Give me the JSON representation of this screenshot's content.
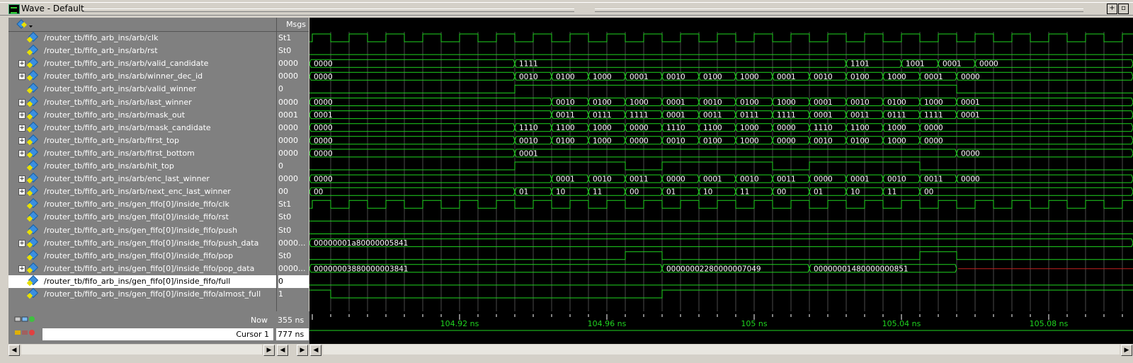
{
  "window": {
    "title": "Wave - Default"
  },
  "names_header": "",
  "values_header": "Msgs",
  "signals": [
    {
      "name": "/router_tb/fifo_arb_ins/arb/clk",
      "value": "St1",
      "expand": false,
      "kind": "clk",
      "period": 2,
      "offset": 0
    },
    {
      "name": "/router_tb/fifo_arb_ins/arb/rst",
      "value": "St0",
      "expand": false,
      "kind": "level",
      "transitions": []
    },
    {
      "name": "/router_tb/fifo_arb_ins/arb/valid_candidate",
      "value": "0000",
      "expand": true,
      "kind": "bus",
      "segs": [
        [
          "0000",
          0
        ],
        [
          "1111",
          11
        ],
        [
          "1101",
          29
        ],
        [
          "1001",
          32
        ],
        [
          "0001",
          34
        ],
        [
          "0000",
          36
        ]
      ]
    },
    {
      "name": "/router_tb/fifo_arb_ins/arb/winner_dec_id",
      "value": "0000",
      "expand": true,
      "kind": "bus",
      "segs": [
        [
          "0000",
          0
        ],
        [
          "0010",
          11
        ],
        [
          "0100",
          13
        ],
        [
          "1000",
          15
        ],
        [
          "0001",
          17
        ],
        [
          "0010",
          19
        ],
        [
          "0100",
          21
        ],
        [
          "1000",
          23
        ],
        [
          "0001",
          25
        ],
        [
          "0010",
          27
        ],
        [
          "0100",
          29
        ],
        [
          "1000",
          31
        ],
        [
          "0001",
          33
        ],
        [
          "0000",
          35
        ]
      ]
    },
    {
      "name": "/router_tb/fifo_arb_ins/arb/valid_winner",
      "value": "0",
      "expand": false,
      "kind": "level",
      "transitions": [
        0,
        11,
        35
      ]
    },
    {
      "name": "/router_tb/fifo_arb_ins/arb/last_winner",
      "value": "0000",
      "expand": true,
      "kind": "bus",
      "segs": [
        [
          "0000",
          0
        ],
        [
          "0010",
          13
        ],
        [
          "0100",
          15
        ],
        [
          "1000",
          17
        ],
        [
          "0001",
          19
        ],
        [
          "0010",
          21
        ],
        [
          "0100",
          23
        ],
        [
          "1000",
          25
        ],
        [
          "0001",
          27
        ],
        [
          "0010",
          29
        ],
        [
          "0100",
          31
        ],
        [
          "1000",
          33
        ],
        [
          "0001",
          35
        ]
      ]
    },
    {
      "name": "/router_tb/fifo_arb_ins/arb/mask_out",
      "value": "0001",
      "expand": true,
      "kind": "bus",
      "segs": [
        [
          "0001",
          0
        ],
        [
          "0011",
          13
        ],
        [
          "0111",
          15
        ],
        [
          "1111",
          17
        ],
        [
          "0001",
          19
        ],
        [
          "0011",
          21
        ],
        [
          "0111",
          23
        ],
        [
          "1111",
          25
        ],
        [
          "0001",
          27
        ],
        [
          "0011",
          29
        ],
        [
          "0111",
          31
        ],
        [
          "1111",
          33
        ],
        [
          "0001",
          35
        ]
      ]
    },
    {
      "name": "/router_tb/fifo_arb_ins/arb/mask_candidate",
      "value": "0000",
      "expand": true,
      "kind": "bus",
      "segs": [
        [
          "0000",
          0
        ],
        [
          "1110",
          11
        ],
        [
          "1100",
          13
        ],
        [
          "1000",
          15
        ],
        [
          "0000",
          17
        ],
        [
          "1110",
          19
        ],
        [
          "1100",
          21
        ],
        [
          "1000",
          23
        ],
        [
          "0000",
          25
        ],
        [
          "1110",
          27
        ],
        [
          "1100",
          29
        ],
        [
          "1000",
          31
        ],
        [
          "0000",
          33
        ]
      ]
    },
    {
      "name": "/router_tb/fifo_arb_ins/arb/first_top",
      "value": "0000",
      "expand": true,
      "kind": "bus",
      "segs": [
        [
          "0000",
          0
        ],
        [
          "0010",
          11
        ],
        [
          "0100",
          13
        ],
        [
          "1000",
          15
        ],
        [
          "0000",
          17
        ],
        [
          "0010",
          19
        ],
        [
          "0100",
          21
        ],
        [
          "1000",
          23
        ],
        [
          "0000",
          25
        ],
        [
          "0010",
          27
        ],
        [
          "0100",
          29
        ],
        [
          "1000",
          31
        ],
        [
          "0000",
          33
        ]
      ]
    },
    {
      "name": "/router_tb/fifo_arb_ins/arb/first_bottom",
      "value": "0000",
      "expand": true,
      "kind": "bus",
      "segs": [
        [
          "0000",
          0
        ],
        [
          "0001",
          11
        ],
        [
          "0000",
          35
        ]
      ]
    },
    {
      "name": "/router_tb/fifo_arb_ins/arb/hit_top",
      "value": "0",
      "expand": false,
      "kind": "level",
      "transitions": [
        0,
        11,
        17,
        19,
        25,
        27,
        33
      ]
    },
    {
      "name": "/router_tb/fifo_arb_ins/arb/enc_last_winner",
      "value": "0000",
      "expand": true,
      "kind": "bus",
      "segs": [
        [
          "0000",
          0
        ],
        [
          "0001",
          13
        ],
        [
          "0010",
          15
        ],
        [
          "0011",
          17
        ],
        [
          "0000",
          19
        ],
        [
          "0001",
          21
        ],
        [
          "0010",
          23
        ],
        [
          "0011",
          25
        ],
        [
          "0000",
          27
        ],
        [
          "0001",
          29
        ],
        [
          "0010",
          31
        ],
        [
          "0011",
          33
        ],
        [
          "0000",
          35
        ]
      ]
    },
    {
      "name": "/router_tb/fifo_arb_ins/arb/next_enc_last_winner",
      "value": "00",
      "expand": true,
      "kind": "bus",
      "segs": [
        [
          "00",
          0
        ],
        [
          "01",
          11
        ],
        [
          "10",
          13
        ],
        [
          "11",
          15
        ],
        [
          "00",
          17
        ],
        [
          "01",
          19
        ],
        [
          "10",
          21
        ],
        [
          "11",
          23
        ],
        [
          "00",
          25
        ],
        [
          "01",
          27
        ],
        [
          "10",
          29
        ],
        [
          "11",
          31
        ],
        [
          "00",
          33
        ]
      ]
    },
    {
      "name": "/router_tb/fifo_arb_ins/gen_fifo[0]/inside_fifo/clk",
      "value": "St1",
      "expand": false,
      "kind": "clk",
      "period": 2,
      "offset": 0
    },
    {
      "name": "/router_tb/fifo_arb_ins/gen_fifo[0]/inside_fifo/rst",
      "value": "St0",
      "expand": false,
      "kind": "level",
      "transitions": []
    },
    {
      "name": "/router_tb/fifo_arb_ins/gen_fifo[0]/inside_fifo/push",
      "value": "St0",
      "expand": false,
      "kind": "level",
      "transitions": []
    },
    {
      "name": "/router_tb/fifo_arb_ins/gen_fifo[0]/inside_fifo/push_data",
      "value": "0000...",
      "expand": true,
      "kind": "bus",
      "segs": [
        [
          "00000001a80000005841",
          0
        ]
      ]
    },
    {
      "name": "/router_tb/fifo_arb_ins/gen_fifo[0]/inside_fifo/pop",
      "value": "St0",
      "expand": false,
      "kind": "level",
      "transitions": [
        0,
        17,
        19,
        33,
        35
      ]
    },
    {
      "name": "/router_tb/fifo_arb_ins/gen_fifo[0]/inside_fifo/pop_data",
      "value": "0000...",
      "expand": true,
      "kind": "bus",
      "segs": [
        [
          "00000003880000003841",
          0
        ],
        [
          "00000002280000007049",
          19
        ],
        [
          "00000001480000000851",
          27
        ],
        [
          "X",
          35
        ]
      ]
    },
    {
      "name": "/router_tb/fifo_arb_ins/gen_fifo[0]/inside_fifo/full",
      "value": "0",
      "expand": false,
      "kind": "level",
      "transitions": [],
      "selected": true
    },
    {
      "name": "/router_tb/fifo_arb_ins/gen_fifo[0]/inside_fifo/almost_full",
      "value": "1",
      "expand": false,
      "kind": "level",
      "transitions": [
        1,
        19
      ]
    }
  ],
  "now": {
    "label": "Now",
    "value": "355 ns"
  },
  "cursor": {
    "label": "Cursor 1",
    "value": "777 ns"
  },
  "timeline": {
    "ticks": [
      {
        "label": "104.92 ns",
        "pos": 8
      },
      {
        "label": "104.96 ns",
        "pos": 16
      },
      {
        "label": "105 ns",
        "pos": 24
      },
      {
        "label": "105.04 ns",
        "pos": 32
      },
      {
        "label": "105.08 ns",
        "pos": 40
      }
    ]
  },
  "colors": {
    "wave": "#1fd31f",
    "bg": "#000000",
    "grid": "#4a4a4a",
    "x_state": "#c02020",
    "names_bg": "#808080"
  },
  "icons": {
    "app": "wave-window-icon",
    "max": "maximize-icon",
    "undock": "undock-icon",
    "signal": "signal-diamond-icon"
  }
}
